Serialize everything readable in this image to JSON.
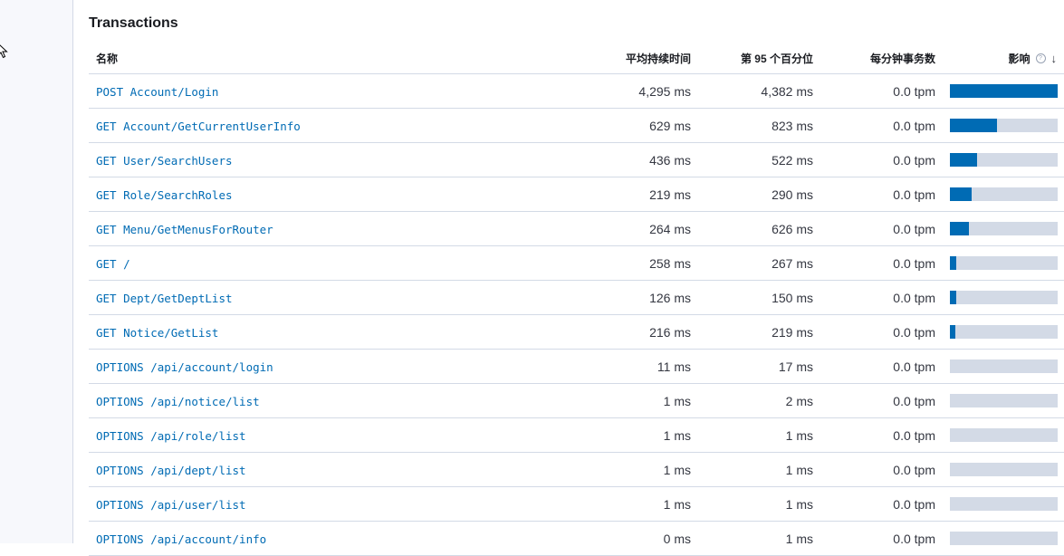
{
  "panel": {
    "title": "Transactions"
  },
  "table": {
    "headers": {
      "name": "名称",
      "avg_duration": "平均持续时间",
      "p95": "第 95 个百分位",
      "tpm": "每分钟事务数",
      "impact": "影响"
    },
    "rows": [
      {
        "name": "POST Account/Login",
        "avg": "4,295 ms",
        "p95": "4,382 ms",
        "tpm": "0.0 tpm",
        "impact": 1.0
      },
      {
        "name": "GET Account/GetCurrentUserInfo",
        "avg": "629 ms",
        "p95": "823 ms",
        "tpm": "0.0 tpm",
        "impact": 0.44
      },
      {
        "name": "GET User/SearchUsers",
        "avg": "436 ms",
        "p95": "522 ms",
        "tpm": "0.0 tpm",
        "impact": 0.25
      },
      {
        "name": "GET Role/SearchRoles",
        "avg": "219 ms",
        "p95": "290 ms",
        "tpm": "0.0 tpm",
        "impact": 0.2
      },
      {
        "name": "GET Menu/GetMenusForRouter",
        "avg": "264 ms",
        "p95": "626 ms",
        "tpm": "0.0 tpm",
        "impact": 0.18
      },
      {
        "name": "GET /",
        "avg": "258 ms",
        "p95": "267 ms",
        "tpm": "0.0 tpm",
        "impact": 0.06
      },
      {
        "name": "GET Dept/GetDeptList",
        "avg": "126 ms",
        "p95": "150 ms",
        "tpm": "0.0 tpm",
        "impact": 0.06
      },
      {
        "name": "GET Notice/GetList",
        "avg": "216 ms",
        "p95": "219 ms",
        "tpm": "0.0 tpm",
        "impact": 0.05
      },
      {
        "name": "OPTIONS /api/account/login",
        "avg": "11 ms",
        "p95": "17 ms",
        "tpm": "0.0 tpm",
        "impact": 0.0
      },
      {
        "name": "OPTIONS /api/notice/list",
        "avg": "1 ms",
        "p95": "2 ms",
        "tpm": "0.0 tpm",
        "impact": 0.0
      },
      {
        "name": "OPTIONS /api/role/list",
        "avg": "1 ms",
        "p95": "1 ms",
        "tpm": "0.0 tpm",
        "impact": 0.0
      },
      {
        "name": "OPTIONS /api/dept/list",
        "avg": "1 ms",
        "p95": "1 ms",
        "tpm": "0.0 tpm",
        "impact": 0.0
      },
      {
        "name": "OPTIONS /api/user/list",
        "avg": "1 ms",
        "p95": "1 ms",
        "tpm": "0.0 tpm",
        "impact": 0.0
      },
      {
        "name": "OPTIONS /api/account/info",
        "avg": "0 ms",
        "p95": "1 ms",
        "tpm": "0.0 tpm",
        "impact": 0.0
      }
    ]
  },
  "icons": {
    "impact_help": "help-icon",
    "sort": "arrow-down-icon",
    "pointer": "mouse-cursor-icon"
  },
  "colors": {
    "link": "#006bb4",
    "bar_fill": "#006bb4",
    "bar_track": "#d3dae6"
  }
}
